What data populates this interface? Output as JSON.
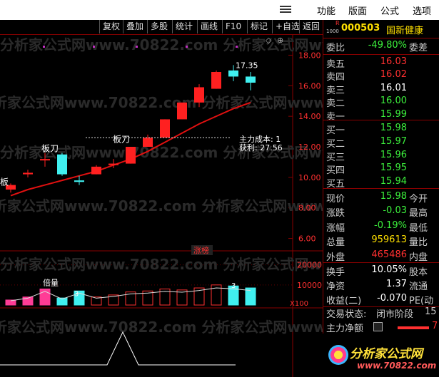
{
  "menu": {
    "items": [
      "功能",
      "版面",
      "公式",
      "选项"
    ]
  },
  "toolbar": {
    "buttons": [
      "复权",
      "叠加",
      "多股",
      "统计",
      "画线",
      "F10",
      "标记",
      "+自选",
      "返回"
    ]
  },
  "stock": {
    "code_prefix": "R",
    "code_sub": "1000",
    "code": "000503",
    "name": "国新健康"
  },
  "ratio": {
    "label": "委比",
    "value": "-49.80%",
    "label2": "委差"
  },
  "asks": [
    {
      "label": "卖五",
      "price": "16.03",
      "color": "#ff3030"
    },
    {
      "label": "卖四",
      "price": "16.02",
      "color": "#ff3030"
    },
    {
      "label": "卖三",
      "price": "16.01",
      "color": "#ffffff"
    },
    {
      "label": "卖二",
      "price": "16.00",
      "color": "#3cf03c"
    },
    {
      "label": "卖一",
      "price": "15.99",
      "color": "#3cf03c"
    }
  ],
  "bids": [
    {
      "label": "买一",
      "price": "15.98",
      "color": "#3cf03c"
    },
    {
      "label": "买二",
      "price": "15.97",
      "color": "#3cf03c"
    },
    {
      "label": "买三",
      "price": "15.96",
      "color": "#3cf03c"
    },
    {
      "label": "买四",
      "price": "15.95",
      "color": "#3cf03c"
    },
    {
      "label": "买五",
      "price": "15.94",
      "color": "#3cf03c"
    }
  ],
  "quote": [
    {
      "label": "现价",
      "value": "15.98",
      "color": "#3cf03c",
      "label2": "今开"
    },
    {
      "label": "涨跌",
      "value": "-0.03",
      "color": "#3cf03c",
      "label2": "最高"
    },
    {
      "label": "涨幅",
      "value": "-0.19%",
      "color": "#3cf03c",
      "label2": "最低"
    },
    {
      "label": "总量",
      "value": "959613",
      "color": "#ffe000",
      "label2": "量比"
    },
    {
      "label": "外盘",
      "value": "465486",
      "color": "#ff3030",
      "label2": "内盘"
    }
  ],
  "finance": [
    {
      "label": "换手",
      "value": "10.05%",
      "label2": "股本"
    },
    {
      "label": "净资",
      "value": "1.37",
      "label2": "流通"
    },
    {
      "label": "收益(二)",
      "value": "-0.070",
      "label2": "PE(动"
    }
  ],
  "status": {
    "label": "交易状态:",
    "value": "闭市阶段",
    "extra": "15"
  },
  "capital": {
    "label": "主力净额",
    "value": "7"
  },
  "price_axis": [
    "18.00",
    "16.00",
    "14.00",
    "12.00",
    "10.00",
    "8.00",
    "6.00"
  ],
  "vol_axis": [
    "20000",
    "10000"
  ],
  "vol_unit": "X100",
  "annotations": {
    "high": "17.35",
    "cost": "主力成本: 1",
    "profit": "获利: 27.56",
    "board1": "板刀",
    "board2": "板刀",
    "limit_tag": "涨榜",
    "vol_tag": "倍量",
    "vol_num1": "3",
    "vol_num2": "3",
    "left_tag": "板"
  },
  "logo": {
    "text": "分析家公式网",
    "url": "www.70822.com"
  },
  "watermark": "分析家公式网www.70822.com",
  "colors": {
    "up": "#ff2020",
    "down": "#40f0f0",
    "ma": "#e01010",
    "accent_red": "#ff3030",
    "accent_green": "#3cf03c"
  },
  "chart_data": {
    "type": "candlestick",
    "candles": [
      {
        "o": 9.2,
        "h": 9.6,
        "l": 9.0,
        "c": 9.5,
        "dir": "up"
      },
      {
        "o": 10.2,
        "h": 10.5,
        "l": 10.0,
        "c": 10.3,
        "dir": "up"
      },
      {
        "o": 11.2,
        "h": 11.6,
        "l": 10.7,
        "c": 11.2,
        "dir": "up"
      },
      {
        "o": 10.2,
        "h": 11.6,
        "l": 10.1,
        "c": 11.5,
        "dir": "down"
      },
      {
        "o": 9.8,
        "h": 10.1,
        "l": 9.5,
        "c": 9.7,
        "dir": "down"
      },
      {
        "o": 10.2,
        "h": 10.8,
        "l": 10.2,
        "c": 10.7,
        "dir": "up"
      },
      {
        "o": 10.8,
        "h": 11.2,
        "l": 10.6,
        "c": 10.9,
        "dir": "up"
      },
      {
        "o": 10.9,
        "h": 12.0,
        "l": 10.9,
        "c": 12.0,
        "dir": "up"
      },
      {
        "o": 12.0,
        "h": 12.8,
        "l": 12.0,
        "c": 12.6,
        "dir": "up"
      },
      {
        "o": 12.6,
        "h": 13.8,
        "l": 12.6,
        "c": 13.8,
        "dir": "up"
      },
      {
        "o": 13.8,
        "h": 14.9,
        "l": 13.8,
        "c": 14.9,
        "dir": "up"
      },
      {
        "o": 14.9,
        "h": 16.1,
        "l": 14.6,
        "c": 15.9,
        "dir": "up"
      },
      {
        "o": 15.8,
        "h": 17.0,
        "l": 15.8,
        "c": 16.9,
        "dir": "up"
      },
      {
        "o": 16.6,
        "h": 17.35,
        "l": 16.3,
        "c": 17.0,
        "dir": "down"
      },
      {
        "o": 16.6,
        "h": 16.9,
        "l": 15.7,
        "c": 16.2,
        "dir": "down"
      }
    ],
    "ma": [
      8.8,
      9.2,
      9.5,
      9.8,
      10.1,
      10.4,
      10.8,
      11.2,
      11.7,
      12.3,
      12.9,
      13.5,
      14.0,
      14.5,
      14.9
    ],
    "volume": [
      2500,
      4000,
      8000,
      3500,
      7000,
      4000,
      5000,
      6500,
      7000,
      8000,
      7500,
      8500,
      10000,
      9500,
      8500
    ],
    "vol_color": [
      "#ff3c96",
      "#ff3c96",
      "#ff3c96",
      "#40f0f0",
      "#40f0f0",
      "#ff3030",
      "#ff3030",
      "#ff3030",
      "#ff3030",
      "#ff3030",
      "#ff3030",
      "#ff3030",
      "#ff3030",
      "#40f0f0",
      "#40f0f0"
    ],
    "ylim": [
      5,
      19
    ],
    "vol_ylim": [
      0,
      22000
    ]
  }
}
